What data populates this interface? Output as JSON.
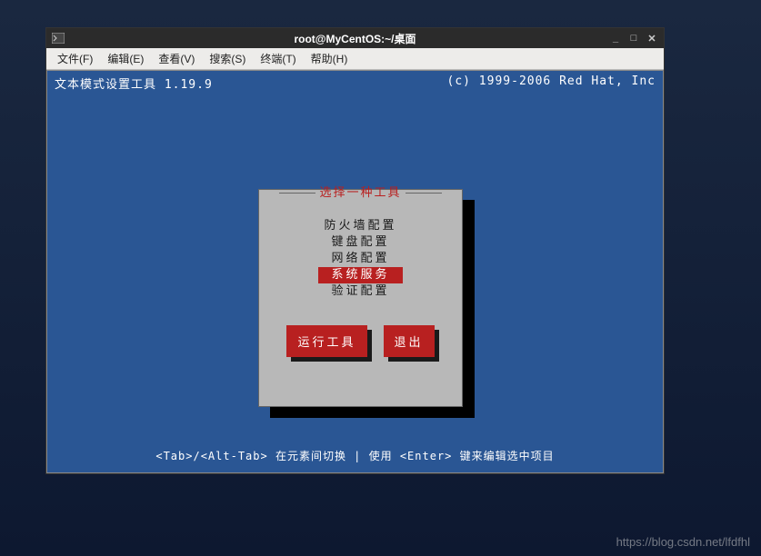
{
  "titlebar": {
    "title": "root@MyCentOS:~/桌面"
  },
  "menubar": {
    "items": [
      "文件(F)",
      "编辑(E)",
      "查看(V)",
      "搜索(S)",
      "终端(T)",
      "帮助(H)"
    ]
  },
  "terminal": {
    "header_left": "文本模式设置工具 1.19.9",
    "header_right": "(c) 1999-2006 Red Hat, Inc",
    "dialog": {
      "title": "选择一种工具",
      "options": [
        "防火墙配置",
        "键盘配置",
        "网络配置",
        "系统服务",
        "验证配置"
      ],
      "selected_index": 3,
      "buttons": {
        "run": "运行工具",
        "quit": "退出"
      }
    },
    "footer": "<Tab>/<Alt-Tab> 在元素间切换   |   使用 <Enter> 键来编辑选中项目"
  },
  "watermark": "https://blog.csdn.net/lfdfhl"
}
